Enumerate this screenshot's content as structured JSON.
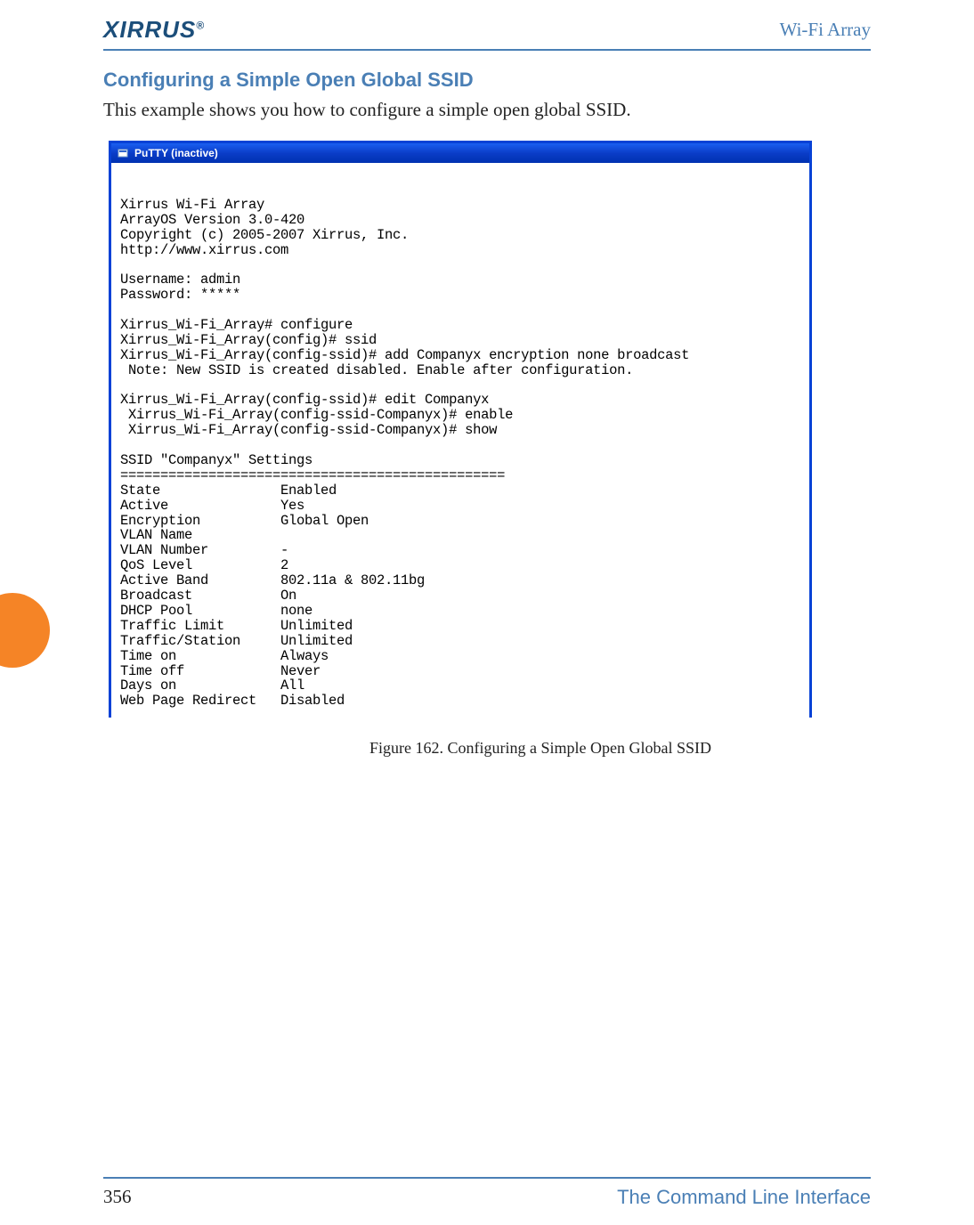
{
  "header": {
    "brand": "XIRRUS",
    "right_label": "Wi-Fi Array"
  },
  "section": {
    "title": "Configuring a Simple Open Global SSID",
    "intro": "This example shows you how to configure a simple open global SSID."
  },
  "terminal": {
    "window_title": "PuTTY (inactive)",
    "content": "\nXirrus Wi-Fi Array\nArrayOS Version 3.0-420\nCopyright (c) 2005-2007 Xirrus, Inc.\nhttp://www.xirrus.com\n\nUsername: admin\nPassword: *****\n\nXirrus_Wi-Fi_Array# configure\nXirrus_Wi-Fi_Array(config)# ssid\nXirrus_Wi-Fi_Array(config-ssid)# add Companyx encryption none broadcast\n Note: New SSID is created disabled. Enable after configuration.\n\nXirrus_Wi-Fi_Array(config-ssid)# edit Companyx\n Xirrus_Wi-Fi_Array(config-ssid-Companyx)# enable\n Xirrus_Wi-Fi_Array(config-ssid-Companyx)# show\n\nSSID \"Companyx\" Settings\n================================================\nState               Enabled\nActive              Yes\nEncryption          Global Open\nVLAN Name\nVLAN Number         -\nQoS Level           2\nActive Band         802.11a & 802.11bg\nBroadcast           On\nDHCP Pool           none\nTraffic Limit       Unlimited\nTraffic/Station     Unlimited\nTime on             Always\nTime off            Never\nDays on             All\nWeb Page Redirect   Disabled"
  },
  "figure": {
    "caption": "Figure 162. Configuring a Simple Open Global SSID"
  },
  "footer": {
    "page_number": "356",
    "section_name": "The Command Line Interface"
  }
}
